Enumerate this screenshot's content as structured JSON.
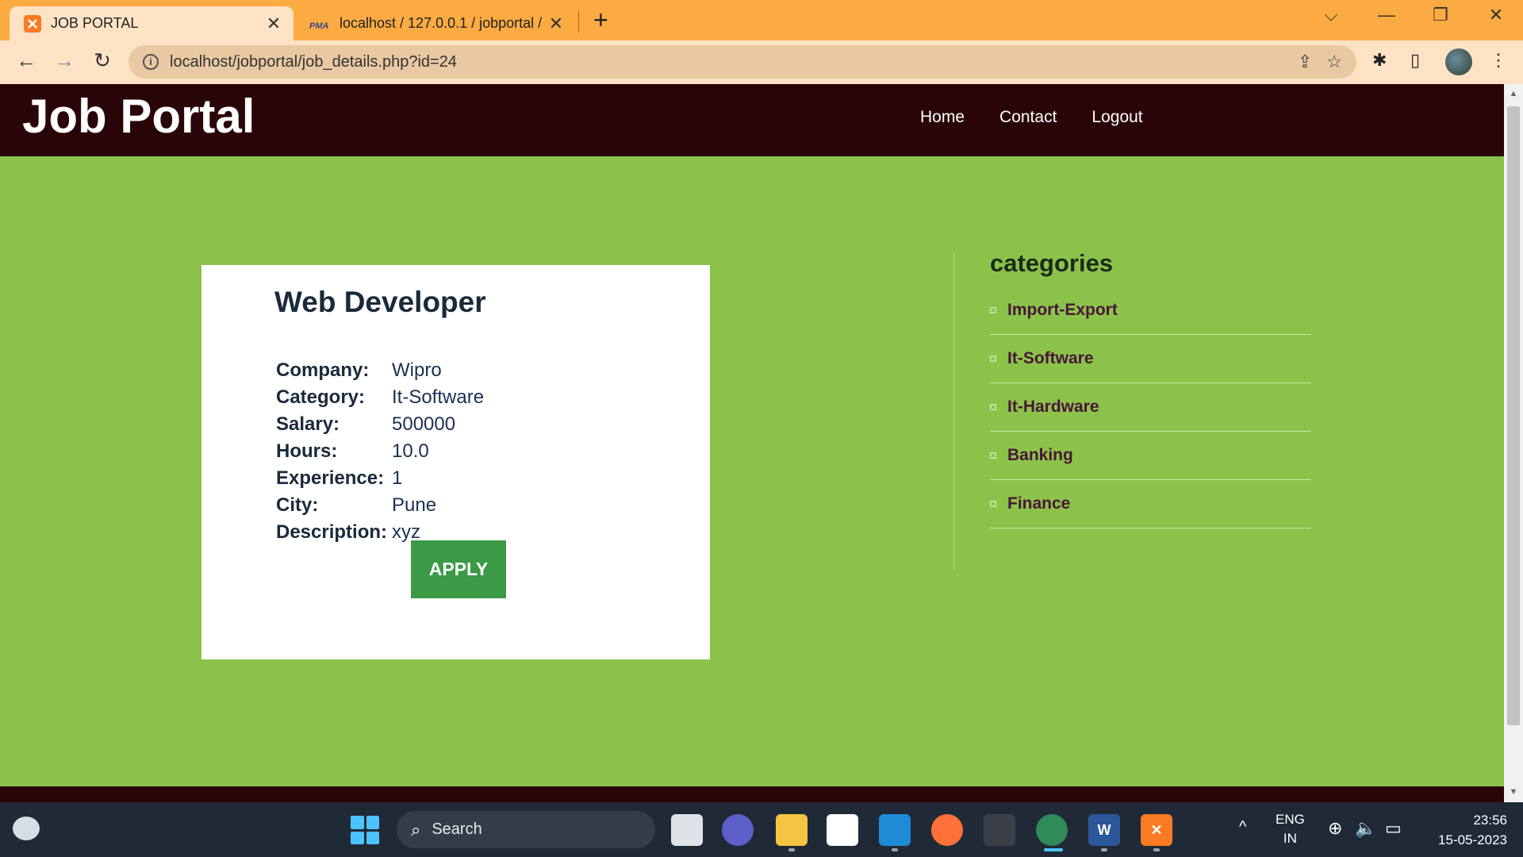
{
  "browser": {
    "tabs": [
      {
        "title": "JOB PORTAL",
        "icon": "xampp-icon",
        "active": true
      },
      {
        "title": "localhost / 127.0.0.1 / jobportal /",
        "icon": "phpmyadmin-icon",
        "active": false
      }
    ],
    "url": "localhost/jobportal/job_details.php?id=24"
  },
  "site": {
    "logo": "Job Portal",
    "nav": [
      "Home",
      "Contact",
      "Logout"
    ]
  },
  "job": {
    "title": "Web Developer",
    "fields": [
      {
        "key": "Company:",
        "value": "Wipro"
      },
      {
        "key": "Category:",
        "value": "It-Software"
      },
      {
        "key": "Salary:",
        "value": "500000"
      },
      {
        "key": "Hours:",
        "value": "10.0"
      },
      {
        "key": "Experience:",
        "value": "1"
      },
      {
        "key": "City:",
        "value": "Pune"
      },
      {
        "key": "Description:",
        "value": "xyz"
      }
    ],
    "apply_label": "APPLY"
  },
  "categories": {
    "title": "categories",
    "items": [
      "Import-Export",
      "It-Software",
      "It-Hardware",
      "Banking",
      "Finance"
    ]
  },
  "taskbar": {
    "search_label": "Search",
    "lang_top": "ENG",
    "lang_bottom": "IN",
    "time": "23:56",
    "date": "15-05-2023"
  },
  "colors": {
    "page_bg": "#8bc34a",
    "header_bg": "#2a0508",
    "apply_bg": "#3a9a45",
    "tab_bar": "#fbab42"
  }
}
